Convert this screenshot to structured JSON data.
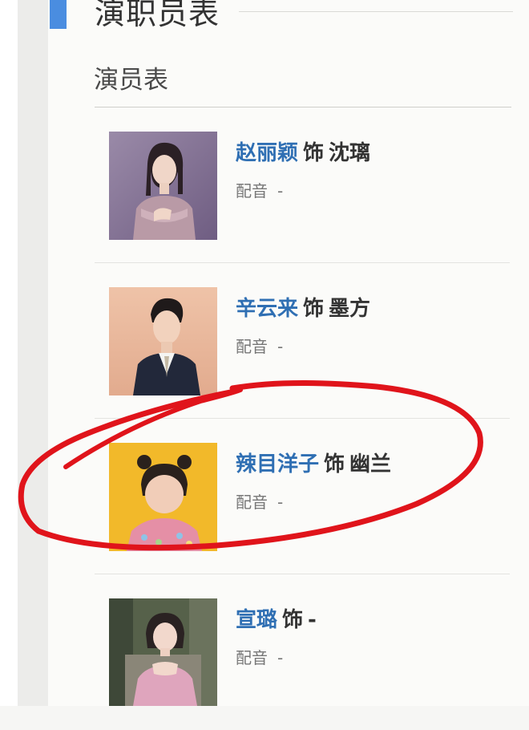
{
  "section": {
    "title": "演职员表"
  },
  "subsection": {
    "title": "演员表"
  },
  "cast": [
    {
      "actor": "赵丽颖",
      "connector": "饰",
      "role": "沈璃",
      "dub_label": "配音",
      "dub_value": "-"
    },
    {
      "actor": "辛云来",
      "connector": "饰",
      "role": "墨方",
      "dub_label": "配音",
      "dub_value": "-"
    },
    {
      "actor": "辣目洋子",
      "connector": "饰",
      "role": "幽兰",
      "dub_label": "配音",
      "dub_value": "-"
    },
    {
      "actor": "宣璐",
      "connector": "饰",
      "role": "-",
      "dub_label": "配音",
      "dub_value": "-"
    }
  ],
  "colors": {
    "accent": "#4a8de0",
    "actor_link": "#2f6fb3",
    "annotation": "#e0141b"
  }
}
